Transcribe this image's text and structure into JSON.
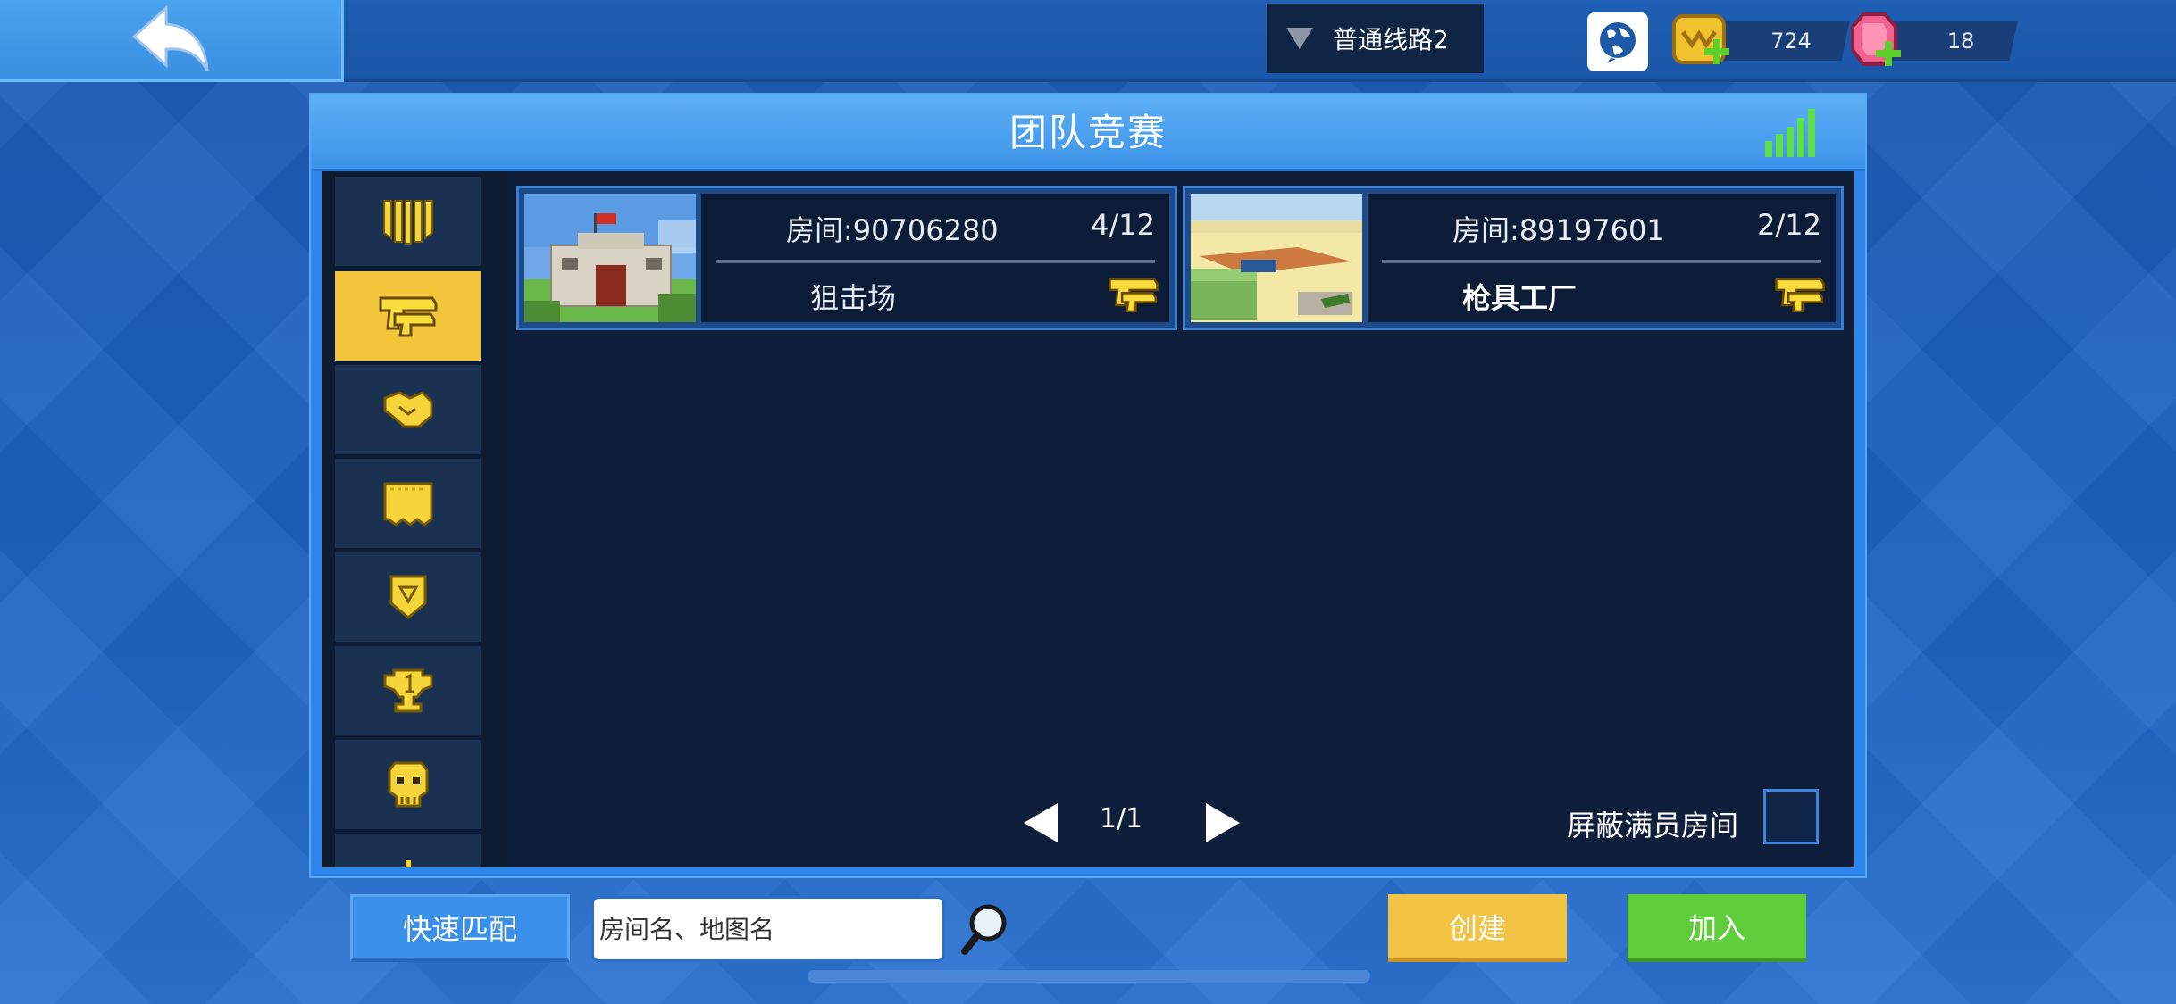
{
  "server": {
    "label": "普通线路2"
  },
  "currency": {
    "coins": "724",
    "gems": "18"
  },
  "panel": {
    "title": "团队竞赛"
  },
  "sidebar": {
    "items": [
      {
        "icon": "crown-stripes-icon"
      },
      {
        "icon": "golden-gun-icon",
        "active": true
      },
      {
        "icon": "handshake-icon"
      },
      {
        "icon": "flag-banner-icon"
      },
      {
        "icon": "shield-badge-icon"
      },
      {
        "icon": "trophy-number-one-icon"
      },
      {
        "icon": "skull-icon"
      },
      {
        "icon": "sword-icon"
      }
    ]
  },
  "rooms": [
    {
      "id_text": "房间:90706280",
      "count": "4/12",
      "map": "狙击场",
      "mode_icon": "golden-gun-icon"
    },
    {
      "id_text": "房间:89197601",
      "count": "2/12",
      "map": "枪具工厂",
      "mode_icon": "golden-gun-icon"
    }
  ],
  "pagination": {
    "page": "1/1"
  },
  "filters": {
    "hide_full_label": "屏蔽满员房间",
    "hide_full_checked": false
  },
  "bottom": {
    "quick_match": "快速匹配",
    "search_placeholder": "房间名、地图名",
    "create": "创建",
    "join": "加入"
  },
  "colors": {
    "accent": "#2e86ea",
    "active_tab": "#f2c53a",
    "create": "#f3c344",
    "join": "#5fcc3a",
    "panel_bg": "#0f1f3b"
  }
}
